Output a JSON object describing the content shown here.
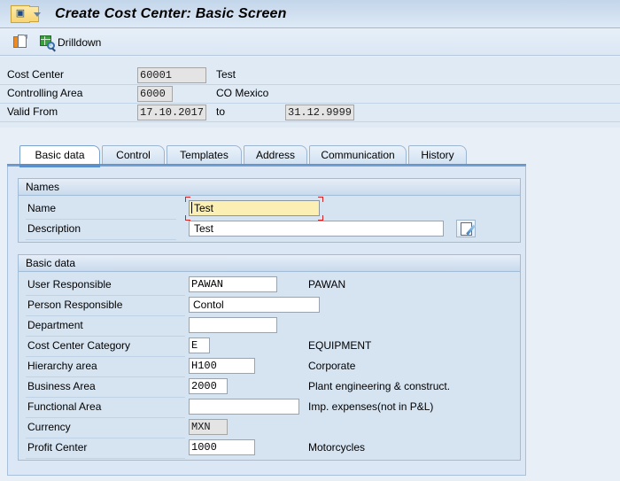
{
  "window": {
    "title": "Create Cost Center: Basic Screen",
    "app_icon": "sap-transaction-icon",
    "dropdown_icon": "chevron-down-icon"
  },
  "toolbar": {
    "items": [
      {
        "label": "",
        "icon": "new-document-icon",
        "name": "new-entry-button"
      },
      {
        "label": "Drilldown",
        "icon": "drilldown-magnifier-icon",
        "name": "drilldown-button"
      }
    ]
  },
  "header": {
    "rows": [
      {
        "label": "Cost Center",
        "value": "60001",
        "desc": "Test"
      },
      {
        "label": "Controlling Area",
        "value": "6000",
        "desc": "CO Mexico"
      },
      {
        "label": "Valid From",
        "value": "17.10.2017",
        "desc": "to",
        "value2": "31.12.9999"
      }
    ]
  },
  "tabs": [
    {
      "label": "Basic data",
      "active": true
    },
    {
      "label": "Control",
      "active": false
    },
    {
      "label": "Templates",
      "active": false
    },
    {
      "label": "Address",
      "active": false
    },
    {
      "label": "Communication",
      "active": false
    },
    {
      "label": "History",
      "active": false
    }
  ],
  "groups": {
    "names": {
      "title": "Names",
      "fields": [
        {
          "label": "Name",
          "value": "Test",
          "desc": "",
          "focused": true
        },
        {
          "label": "Description",
          "value": "Test",
          "desc": "",
          "focused": false
        }
      ],
      "edit_button_icon": "edit-pencil-icon"
    },
    "basic_data": {
      "title": "Basic data",
      "fields": [
        {
          "label": "User Responsible",
          "value": "PAWAN",
          "desc": "PAWAN"
        },
        {
          "label": "Person Responsible",
          "value": "Contol",
          "desc": ""
        },
        {
          "label": "Department",
          "value": "",
          "desc": ""
        },
        {
          "label": "Cost Center Category",
          "value": "E",
          "desc": "EQUIPMENT"
        },
        {
          "label": "Hierarchy area",
          "value": "H100",
          "desc": "Corporate"
        },
        {
          "label": "Business Area",
          "value": "2000",
          "desc": "Plant engineering & construct."
        },
        {
          "label": "Functional Area",
          "value": "",
          "desc": "Imp. expenses(not in P&L)"
        },
        {
          "label": "Currency",
          "value": "MXN",
          "desc": ""
        },
        {
          "label": "Profit Center",
          "value": "1000",
          "desc": "Motorcycles"
        }
      ]
    }
  },
  "colors": {
    "title_bar": "#c3d6ea",
    "panel_background": "#dbe7f4",
    "group_background": "#d6e4f2",
    "active_tab_accent": "#5b8fc9",
    "focus_marker": "#d42020",
    "focused_field": "#fbefb4"
  }
}
